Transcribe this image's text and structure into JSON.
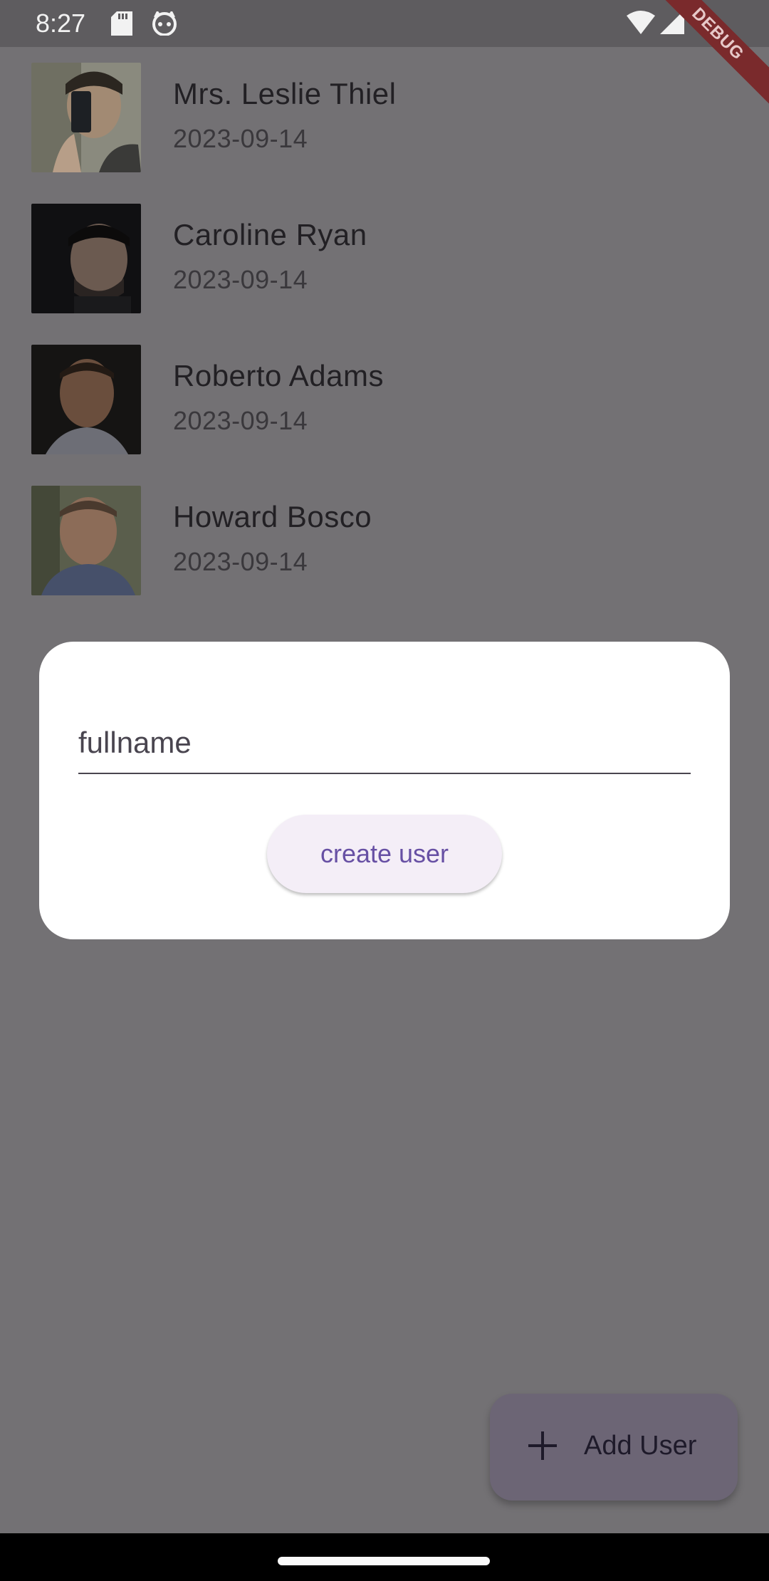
{
  "status_bar": {
    "time": "8:27",
    "debug_label": "DEBUG",
    "icons": [
      "sd-card-icon",
      "cat-face-icon",
      "wifi-icon",
      "signal-icon"
    ]
  },
  "users": [
    {
      "name": "Mrs. Leslie Thiel",
      "date": "2023-09-14"
    },
    {
      "name": "Caroline Ryan",
      "date": "2023-09-14"
    },
    {
      "name": "Roberto Adams",
      "date": "2023-09-14"
    },
    {
      "name": "Howard Bosco",
      "date": "2023-09-14"
    }
  ],
  "dialog": {
    "fullname_placeholder": "fullname",
    "fullname_value": "",
    "create_label": "create user"
  },
  "fab": {
    "label": "Add User",
    "icon": "plus-icon"
  },
  "colors": {
    "scrim_background": "#737174",
    "dialog_background": "#ffffff",
    "button_text": "#6750a4",
    "fab_background": "#6c6575"
  }
}
